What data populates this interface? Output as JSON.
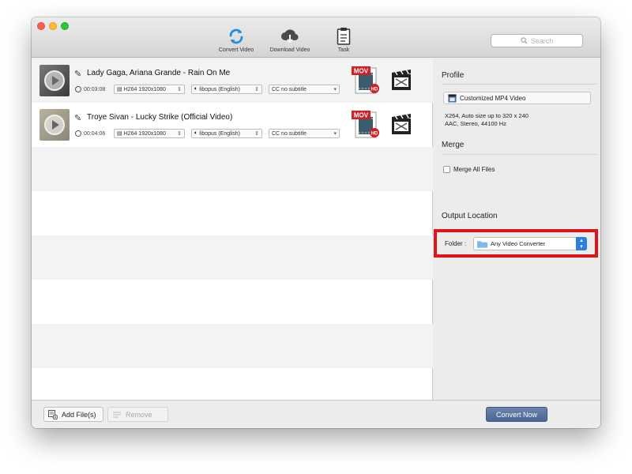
{
  "toolbar": {
    "convert_label": "Convert Video",
    "download_label": "Download Video",
    "task_label": "Task",
    "search_placeholder": "Search"
  },
  "files": [
    {
      "title": "Lady Gaga, Ariana Grande - Rain On Me",
      "duration": "00:03:08",
      "video": "H264 1920x1080",
      "audio": "libopus (English)",
      "subtitle": "CC no subtitle",
      "format_badge": "MOV",
      "hd_badge": "HD"
    },
    {
      "title": "Troye Sivan - Lucky Strike (Official Video)",
      "duration": "00:04:06",
      "video": "H264 1920x1080",
      "audio": "libopus (English)",
      "subtitle": "CC no subtitle",
      "format_badge": "MOV",
      "hd_badge": "HD"
    }
  ],
  "panel": {
    "profile_heading": "Profile",
    "profile_value": "Customized MP4 Video",
    "profile_desc_line1": "X264, Auto size up to 320 x 240",
    "profile_desc_line2": "AAC, Stereo, 44100 Hz",
    "merge_heading": "Merge",
    "merge_checkbox": "Merge All Files",
    "output_heading": "Output Location",
    "folder_label": "Folder :",
    "folder_value": "Any Video Converter"
  },
  "bottom": {
    "add_files": "Add File(s)",
    "remove": "Remove",
    "convert_now": "Convert Now"
  },
  "colors": {
    "highlight_border": "#e0131a",
    "convert_button": "#5670a0",
    "select_stepper": "#2a7fe5",
    "convert_icon": "#1e8ee0"
  }
}
